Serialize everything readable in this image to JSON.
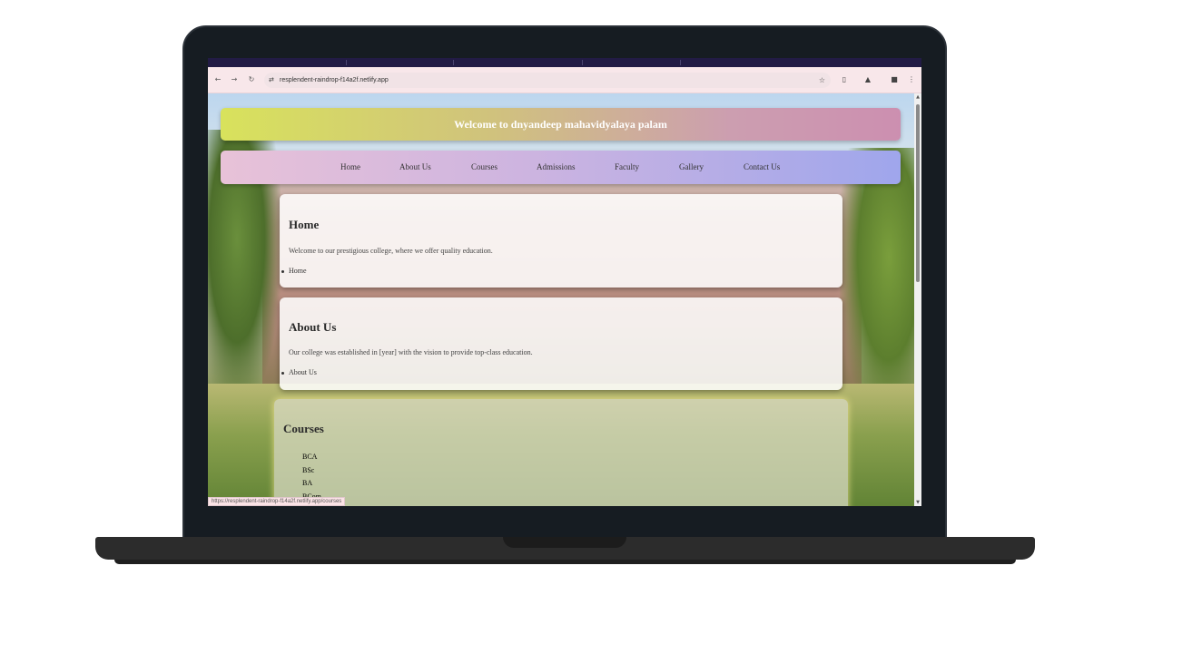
{
  "browser": {
    "url": "resplendent-raindrop-f14a2f.netlify.app",
    "status_url": "https://resplendent-raindrop-f14a2f.netlify.app/courses",
    "icons": {
      "back": "arrow-left-icon",
      "forward": "arrow-right-icon",
      "reload": "reload-icon",
      "site_info": "tune-icon",
      "bookmark": "star-icon",
      "extensions": "puzzle-icon",
      "profile": "profile-icon",
      "menu": "kebab-menu-icon"
    }
  },
  "page": {
    "header": "Welcome to dnyandeep mahavidyalaya palam",
    "nav": [
      "Home",
      "About Us",
      "Courses",
      "Admissions",
      "Faculty",
      "Gallery",
      "Contact Us"
    ],
    "home": {
      "title": "Home",
      "text": "Welcome to our prestigious college, where we offer quality education.",
      "link": "Home"
    },
    "about": {
      "title": "About Us",
      "text": "Our college was established in [year] with the vision to provide top-class education.",
      "link": "About Us"
    },
    "courses": {
      "title": "Courses",
      "items": [
        "BCA",
        "BSc",
        "BA",
        "BCom"
      ]
    }
  },
  "colors": {
    "header_gradient_start": "#d8e25c",
    "header_gradient_end": "#cc8fb0",
    "nav_gradient_start": "#e8c2d8",
    "nav_gradient_end": "#9fa6ec",
    "browser_toolbar": "#f8e7ea",
    "laptop_bezel": "#161c22"
  }
}
